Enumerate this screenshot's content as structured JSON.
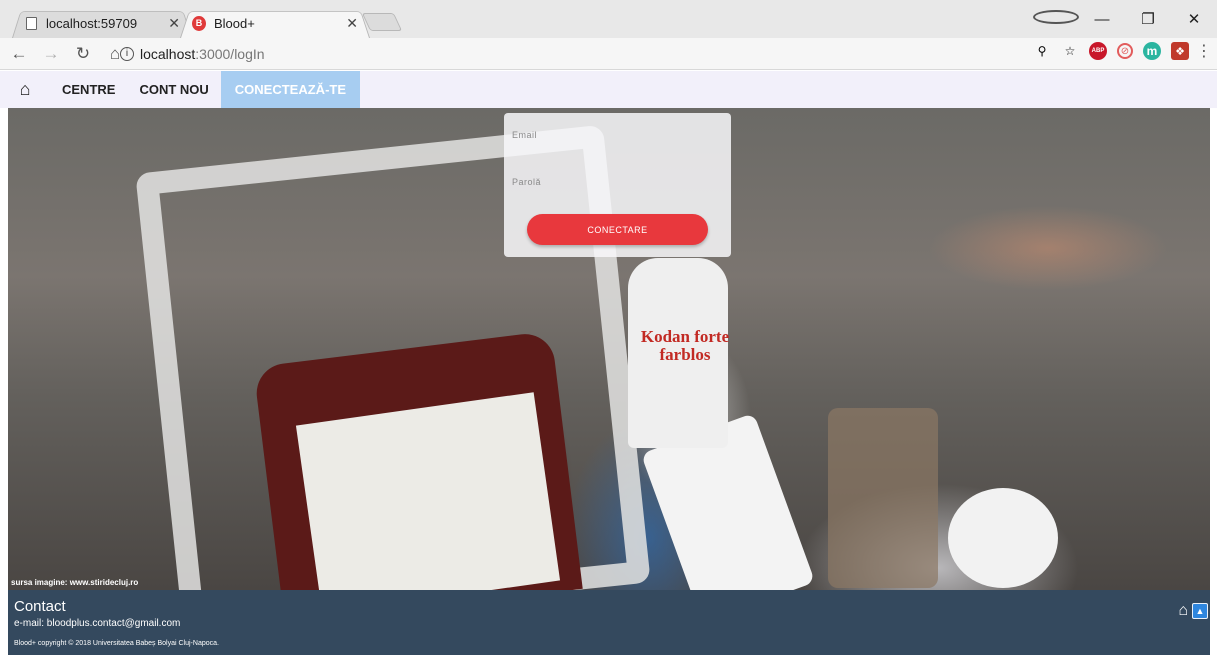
{
  "browser": {
    "tabs": [
      {
        "title": "localhost:59709",
        "active": false
      },
      {
        "title": "Blood+",
        "active": true
      }
    ],
    "url_host": "localhost",
    "url_path": ":3000/logIn",
    "icons": [
      "profile-icon",
      "minimize-icon",
      "maximize-icon",
      "close-icon",
      "back-icon",
      "forward-icon",
      "reload-icon",
      "home-icon",
      "zoom-icon",
      "star-icon",
      "adblock-icon",
      "block-icon",
      "m-extension-icon",
      "gift-extension-icon",
      "menu-icon"
    ]
  },
  "nav": {
    "items": [
      {
        "label": "CENTRE"
      },
      {
        "label": "CONT NOU"
      },
      {
        "label": "CONECTEAZĂ-TE",
        "active": true
      }
    ]
  },
  "login": {
    "email_placeholder": "Email",
    "password_placeholder": "Parolă",
    "submit_label": "CONECTARE",
    "button_color": "#e8383d"
  },
  "hero": {
    "bottle_text": "Kodan forte farblos",
    "photo_credit": "sursa imagine: www.stiridecluj.ro"
  },
  "footer": {
    "title": "Contact",
    "email": "e-mail: bloodplus.contact@gmail.com",
    "copyright": "Blood+ copyright © 2018 Universitatea Babeș Bolyai Cluj-Napoca."
  },
  "colors": {
    "nav_bg": "#f2f0fa",
    "nav_active": "#a7cdf1",
    "footer_bg": "#34495e"
  }
}
